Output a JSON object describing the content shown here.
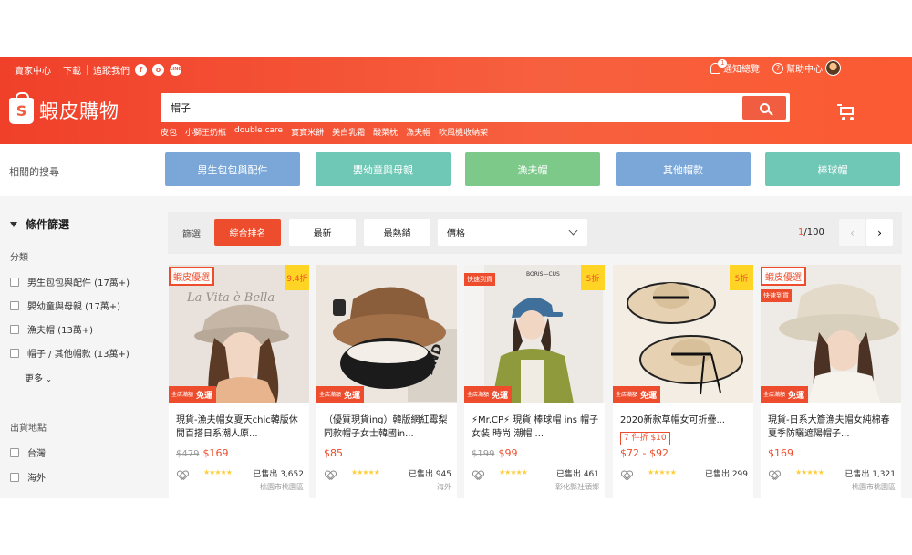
{
  "header": {
    "topnav": [
      "賣家中心",
      "下載",
      "追蹤我們"
    ],
    "social": [
      "f",
      "o",
      "LINE"
    ],
    "notification_label": "通知總覽",
    "notification_count": "1",
    "help_label": "幫助中心",
    "logo_letter": "S",
    "logo_text": "蝦皮購物",
    "search_value": "帽子",
    "hot_words": [
      "皮包",
      "小獅王奶瓶",
      "double care",
      "寶寶米餅",
      "美白乳霜",
      "酸菜枕",
      "漁夫帽",
      "吹風機收納架"
    ]
  },
  "related": {
    "label": "相關的搜尋",
    "buttons": [
      {
        "label": "男生包包與配件",
        "color": "#7aa7d8"
      },
      {
        "label": "嬰幼童與母親",
        "color": "#6fc8b6"
      },
      {
        "label": "漁夫帽",
        "color": "#7dc98a"
      },
      {
        "label": "其他帽款",
        "color": "#7aa7d8"
      },
      {
        "label": "棒球帽",
        "color": "#6fc8b6"
      }
    ]
  },
  "sidebar": {
    "title": "條件篩選",
    "category_label": "分類",
    "categories": [
      "男生包包與配件 (17萬+)",
      "嬰幼童與母親 (17萬+)",
      "漁夫帽 (13萬+)",
      "帽子 / 其他帽款 (13萬+)"
    ],
    "more_label": "更多",
    "location_label": "出貨地點",
    "locations": [
      "台灣",
      "海外"
    ]
  },
  "sortbar": {
    "label": "篩選",
    "options": [
      "綜合排名",
      "最新",
      "最熱銷"
    ],
    "price_label": "價格",
    "page_current": "1",
    "page_total": "/100"
  },
  "products": [
    {
      "title": "現貨-漁夫帽女夏天chic韓版休閒百搭日系潮人原...",
      "orig_price": "$479",
      "price": "$169",
      "sold": "已售出 3,652",
      "location": "桃園市桃園區",
      "discount": "9.4折",
      "badge": "蝦皮優選",
      "free_shipping": "免運",
      "free_small": "全店滿額"
    },
    {
      "title": "（優質現貨ing）韓版網紅霉梨同款帽子女士韓國in...",
      "orig_price": "",
      "price": "$85",
      "sold": "已售出 945",
      "location": "海外",
      "discount": "",
      "badge": "",
      "free_shipping": "免運",
      "free_small": "全店滿額"
    },
    {
      "title": "⚡Mr.CP⚡ 現貨 棒球帽 ins 帽子 女裝 時尚 潮帽 ...",
      "orig_price": "$199",
      "price": "$99",
      "sold": "已售出 461",
      "location": "彰化縣社頭鄉",
      "discount": "5折",
      "badge": "快速到貨",
      "free_shipping": "免運",
      "free_small": "全店滿額"
    },
    {
      "title": "2020新款草帽女可折疊...",
      "orig_price": "",
      "price": "$72 - $92",
      "sold": "已售出 299",
      "location": "",
      "discount": "5折",
      "badge": "",
      "promo": "7 件折 $10",
      "free_shipping": "免運",
      "free_small": "全店滿額"
    },
    {
      "title": "現貨-日系大簷漁夫帽女純棉春夏季防曬遮陽帽子...",
      "orig_price": "",
      "price": "$169",
      "sold": "已售出 1,321",
      "location": "桃園市桃園區",
      "discount": "",
      "badge": "蝦皮優選",
      "badge2": "快速到貨",
      "free_shipping": "免運",
      "free_small": "全店滿額"
    }
  ],
  "rating_stars": "★★★★★"
}
